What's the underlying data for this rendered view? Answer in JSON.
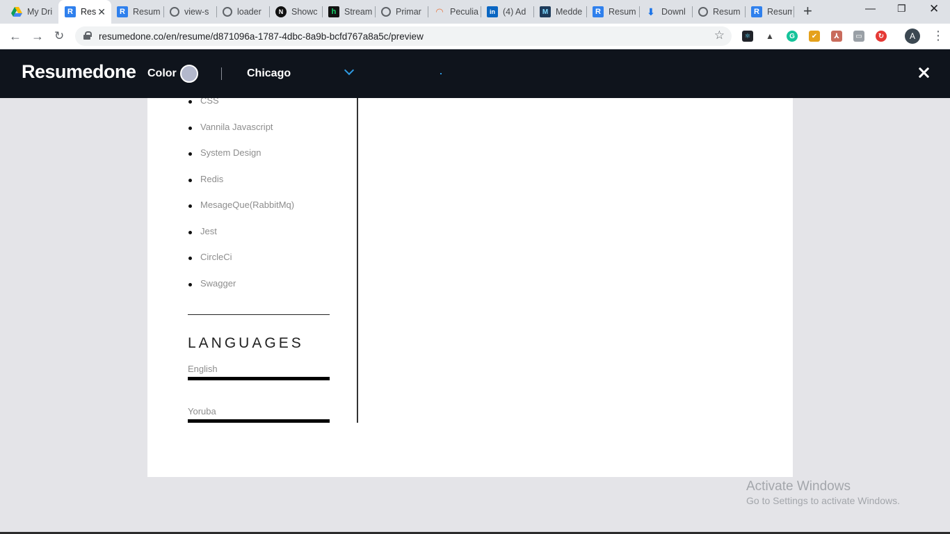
{
  "browser": {
    "tabs": [
      {
        "title": "My Dri",
        "icon": "drive-icon"
      },
      {
        "title": "Res",
        "icon": "resumedone-icon",
        "active": true
      },
      {
        "title": "Resum",
        "icon": "resumedone-icon"
      },
      {
        "title": "view-s",
        "icon": "globe-icon"
      },
      {
        "title": "loader",
        "icon": "globe-icon"
      },
      {
        "title": "Showc",
        "icon": "n-icon"
      },
      {
        "title": "Stream",
        "icon": "h-icon"
      },
      {
        "title": "Primar",
        "icon": "globe-icon"
      },
      {
        "title": "Peculia",
        "icon": "rainbow-icon"
      },
      {
        "title": "(4) Ad",
        "icon": "linkedin-icon"
      },
      {
        "title": "Medde",
        "icon": "medde-icon"
      },
      {
        "title": "Resum",
        "icon": "resumedone-icon"
      },
      {
        "title": "Downl",
        "icon": "download-icon"
      },
      {
        "title": "Resum",
        "icon": "globe-icon"
      },
      {
        "title": "Resum",
        "icon": "resumedone-icon"
      }
    ],
    "url": "resumedone.co/en/resume/d871096a-1787-4dbc-8a9b-bcfd767a8a5c/preview",
    "profile_initial": "A"
  },
  "app": {
    "brand": "Resumedone",
    "color_label": "Color",
    "color_value": "#b3b8cc",
    "template": "Chicago"
  },
  "resume": {
    "skills": [
      "CSS",
      "Vannila Javascript",
      "System Design",
      "Redis",
      "MesageQue(RabbitMq)",
      "Jest",
      "CircleCi",
      "Swagger"
    ],
    "languages_heading": "LANGUAGES",
    "languages": [
      {
        "name": "English",
        "level": 1.0
      },
      {
        "name": "Yoruba",
        "level": 1.0
      }
    ]
  },
  "watermark": {
    "title": "Activate Windows",
    "subtitle": "Go to Settings to activate Windows."
  }
}
